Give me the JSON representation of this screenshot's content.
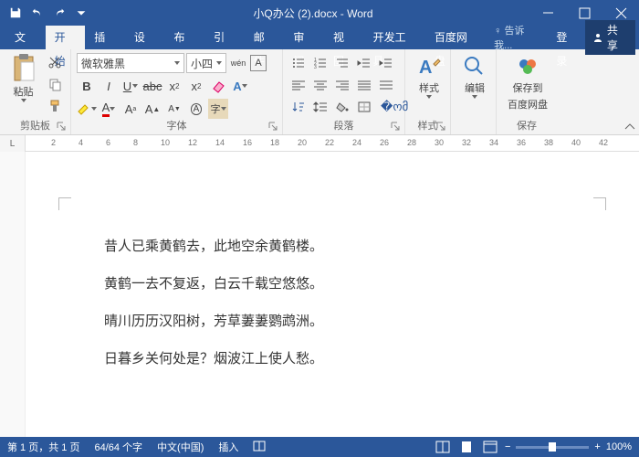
{
  "titlebar": {
    "title": "小Q办公 (2).docx - Word"
  },
  "menus": {
    "file": "文件",
    "home": "开始",
    "insert": "插入",
    "design": "设计",
    "layout": "布局",
    "references": "引用",
    "mailings": "邮件",
    "review": "审阅",
    "view": "视图",
    "devtools": "开发工具",
    "baidu": "百度网盘",
    "tellme": "告诉我...",
    "login": "登录",
    "share": "共享"
  },
  "ribbon": {
    "clipboard": {
      "paste": "粘贴",
      "group": "剪贴板"
    },
    "font": {
      "name": "微软雅黑",
      "size": "小四",
      "group": "字体",
      "ruby": "wén"
    },
    "paragraph": {
      "group": "段落"
    },
    "styles": {
      "label": "样式",
      "group": "样式"
    },
    "editing": {
      "label": "编辑"
    },
    "save": {
      "label1": "保存到",
      "label2": "百度网盘",
      "group": "保存"
    }
  },
  "ruler": {
    "corner": "L",
    "marks": [
      "2",
      "4",
      "6",
      "8",
      "10",
      "12",
      "14",
      "16",
      "18",
      "20",
      "22",
      "24",
      "26",
      "28",
      "30",
      "32",
      "34",
      "36",
      "38",
      "40",
      "42"
    ]
  },
  "document": {
    "lines": [
      "昔人已乘黄鹤去，此地空余黄鹤楼。",
      "黄鹤一去不复返，白云千载空悠悠。",
      "晴川历历汉阳树，芳草萋萋鹦鹉洲。",
      "日暮乡关何处是？烟波江上使人愁。"
    ]
  },
  "status": {
    "page": "第 1 页，共 1 页",
    "words": "64/64 个字",
    "lang": "中文(中国)",
    "mode": "插入",
    "zoom": "100%"
  }
}
